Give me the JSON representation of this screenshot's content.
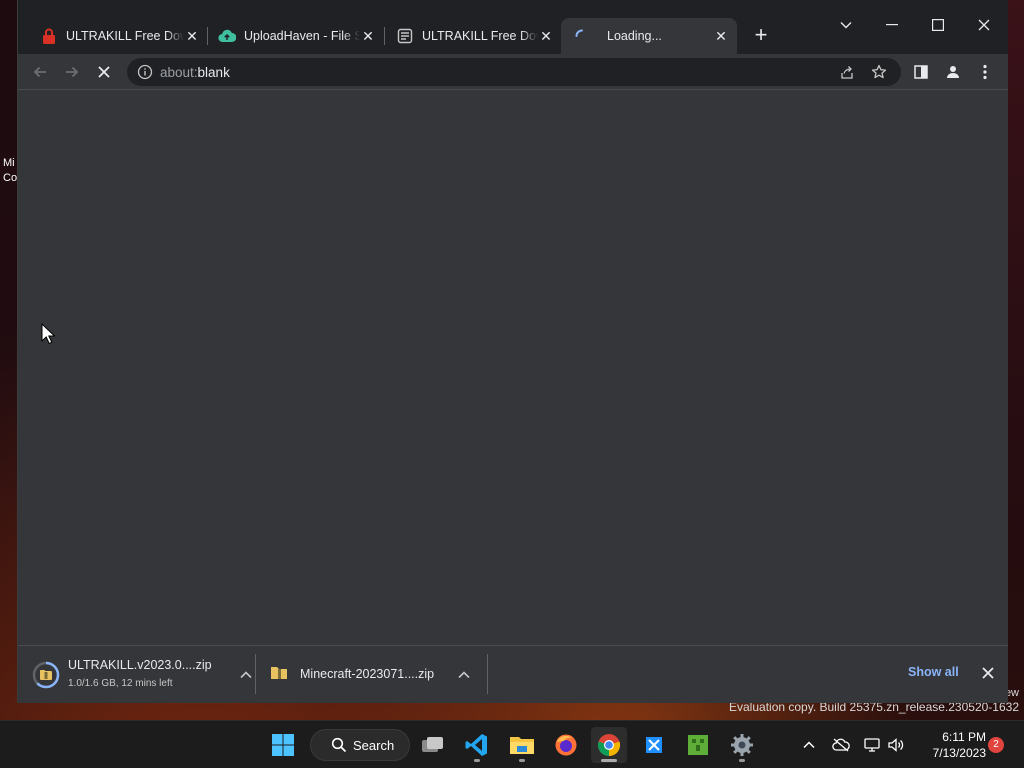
{
  "desktop": {
    "icon_label_line1": "Mi",
    "icon_label_line2": "Co",
    "watermark_line1": "ew",
    "watermark_line2": "Evaluation copy. Build 25375.zn_release.230520-1632"
  },
  "browser": {
    "tabs": [
      {
        "title": "ULTRAKILL Free Download",
        "icon": "red-lock-site-icon",
        "active": false
      },
      {
        "title": "UploadHaven - File Sharing",
        "icon": "cloud-upload-site-icon",
        "active": false
      },
      {
        "title": "ULTRAKILL Free Download",
        "icon": "page-document-site-icon",
        "active": false
      },
      {
        "title": "Loading...",
        "icon": "loading-spinner-icon",
        "active": true
      }
    ],
    "address": {
      "scheme": "about:",
      "host": "blank"
    },
    "download_bar": {
      "items": [
        {
          "name": "ULTRAKILL.v2023.0....zip",
          "status": "1.0/1.6 GB, 12 mins left",
          "progress": 0.625
        },
        {
          "name": "Minecraft-2023071....zip",
          "status": ""
        }
      ],
      "show_all_label": "Show all"
    }
  },
  "taskbar": {
    "search_label": "Search",
    "time": "6:11 PM",
    "date": "7/13/2023",
    "notification_count": "2"
  },
  "colors": {
    "browser_frame": "#202124",
    "browser_surface": "#35363a",
    "link_blue": "#8ab4f8",
    "taskbar": "#1c1c1c",
    "badge_red": "#e0443e"
  }
}
